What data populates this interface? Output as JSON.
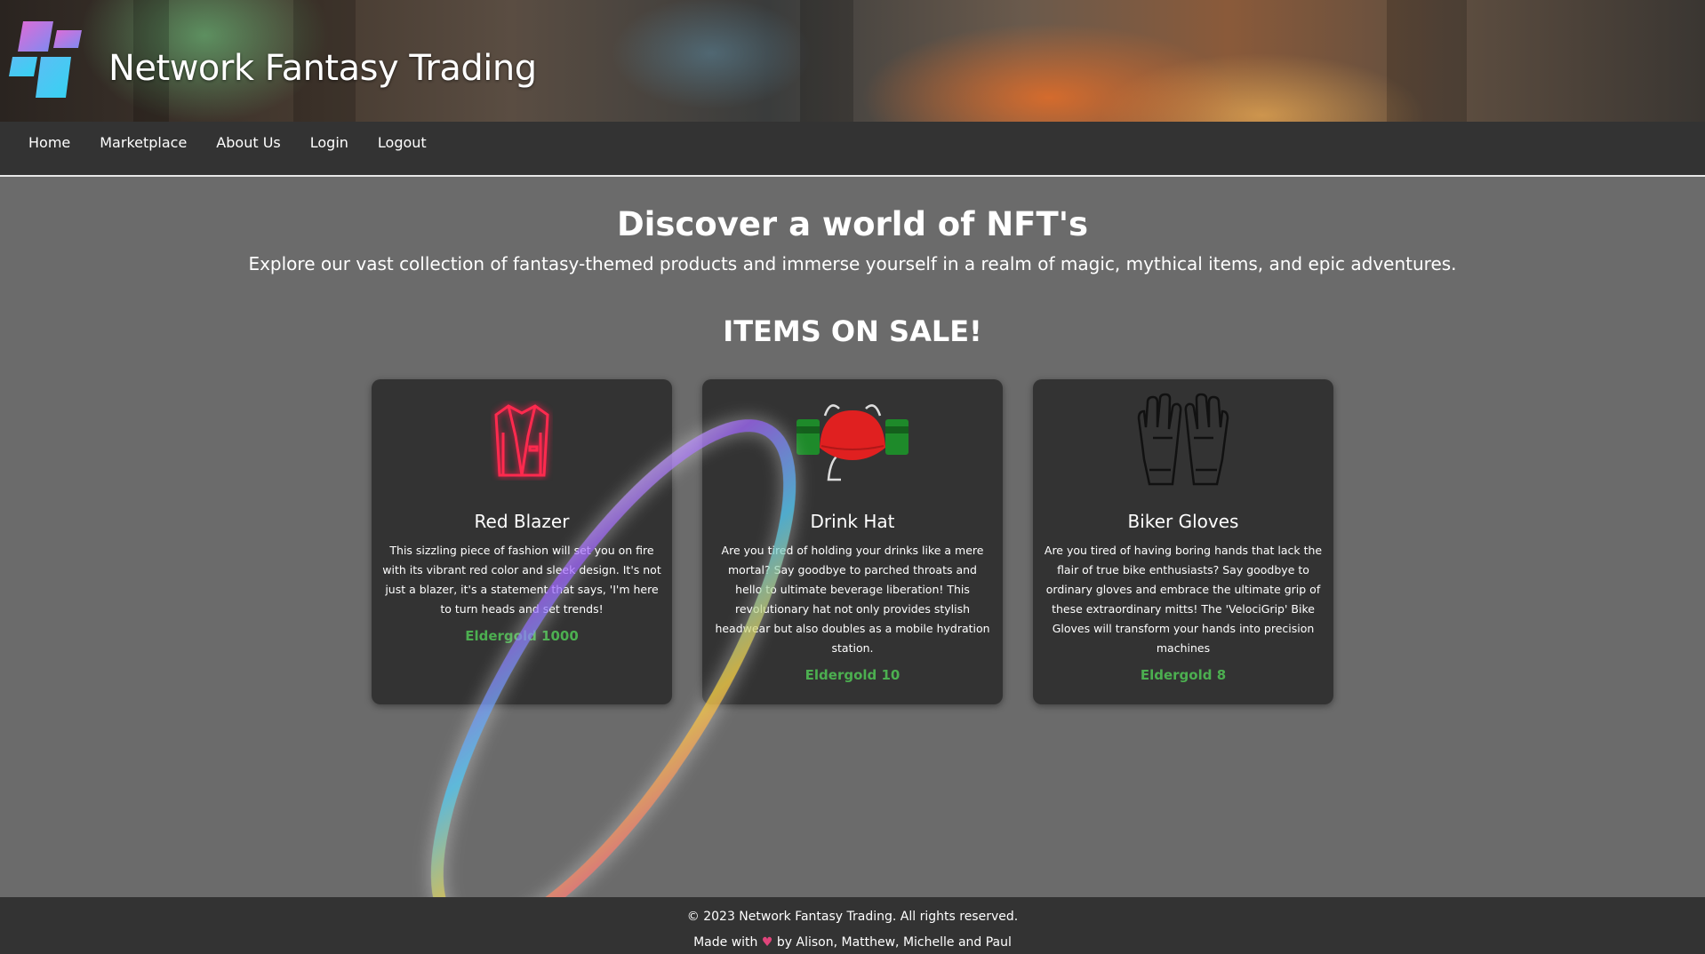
{
  "site": {
    "title": "Network Fantasy Trading"
  },
  "nav": {
    "items": [
      {
        "label": "Home"
      },
      {
        "label": "Marketplace"
      },
      {
        "label": "About Us"
      },
      {
        "label": "Login"
      },
      {
        "label": "Logout"
      }
    ]
  },
  "hero": {
    "heading": "Discover a world of NFT's",
    "subtitle": "Explore our vast collection of fantasy-themed products and immerse yourself in a realm of magic, mythical items, and epic adventures."
  },
  "sale": {
    "heading": "ITEMS ON SALE!",
    "items": [
      {
        "name": "Red Blazer",
        "icon": "red-blazer-icon",
        "description": "This sizzling piece of fashion will set you on fire with its vibrant red color and sleek design. It's not just a blazer, it's a statement that says, 'I'm here to turn heads and set trends!",
        "price": "Eldergold 1000"
      },
      {
        "name": "Drink Hat",
        "icon": "drink-hat-icon",
        "description": "Are you tired of holding your drinks like a mere mortal? Say goodbye to parched throats and hello to ultimate beverage liberation! This revolutionary hat not only provides stylish headwear but also doubles as a mobile hydration station.",
        "price": "Eldergold 10"
      },
      {
        "name": "Biker Gloves",
        "icon": "biker-gloves-icon",
        "description": "Are you tired of having boring hands that lack the flair of true bike enthusiasts? Say goodbye to ordinary gloves and embrace the ultimate grip of these extraordinary mitts! The 'VelociGrip' Bike Gloves will transform your hands into precision machines",
        "price": "Eldergold 8"
      }
    ]
  },
  "footer": {
    "copyright": "© 2023 Network Fantasy Trading. All rights reserved.",
    "made_with_prefix": "Made with",
    "heart": "♥",
    "made_with_suffix": "by Alison, Matthew, Michelle and Paul"
  },
  "colors": {
    "price": "#4caf50",
    "card_bg": "#333333",
    "page_bg": "#6b6b6b",
    "nav_bg": "#333333",
    "heart": "#e0457b"
  }
}
